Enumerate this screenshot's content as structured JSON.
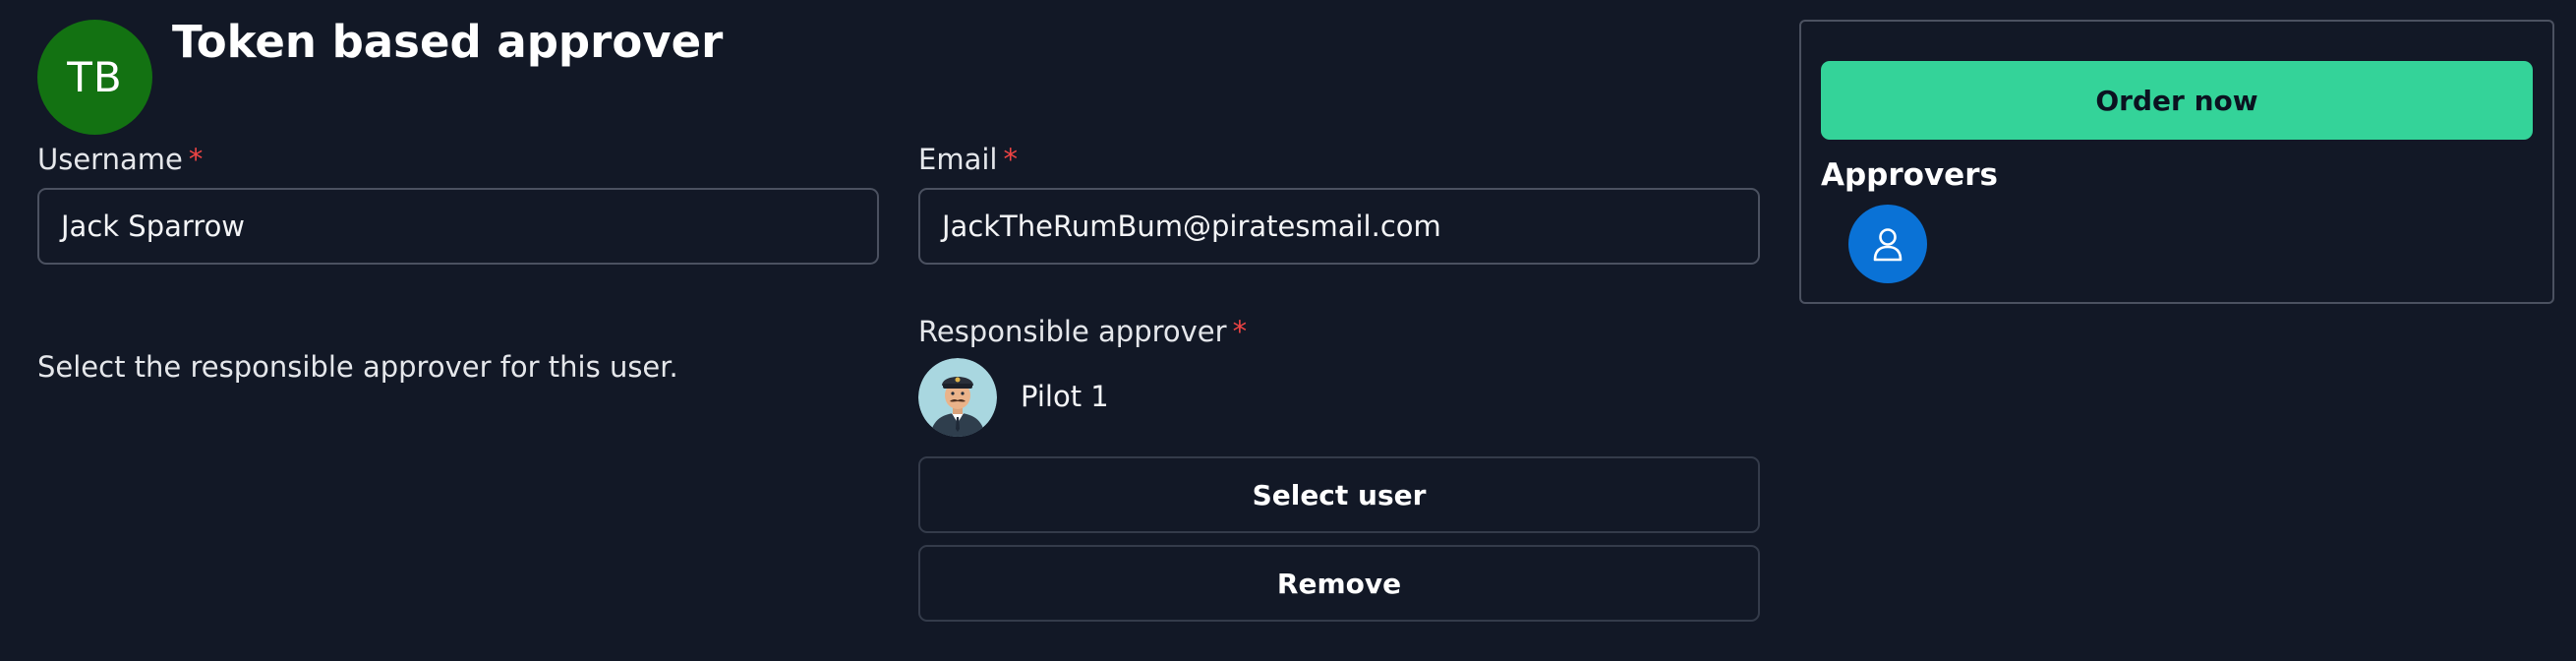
{
  "header": {
    "initials": "TB",
    "title": "Token based approver"
  },
  "form": {
    "username": {
      "label": "Username",
      "required_mark": "*",
      "value": "Jack Sparrow"
    },
    "email": {
      "label": "Email",
      "required_mark": "*",
      "value": "JackTheRumBum@piratesmail.com"
    },
    "approver_help": "Select the responsible approver for this user.",
    "responsible_approver": {
      "label": "Responsible approver",
      "required_mark": "*",
      "selected_name": "Pilot 1",
      "avatar_icon": "pilot-avatar",
      "select_label": "Select user",
      "remove_label": "Remove"
    }
  },
  "order_panel": {
    "order_label": "Order now",
    "approvers_heading": "Approvers",
    "approver_icon": "user-icon"
  },
  "colors": {
    "background": "#121826",
    "avatar_green": "#137212",
    "accent_green": "#34d399",
    "approver_blue": "#0a72d6",
    "required_red": "#ef4444"
  }
}
